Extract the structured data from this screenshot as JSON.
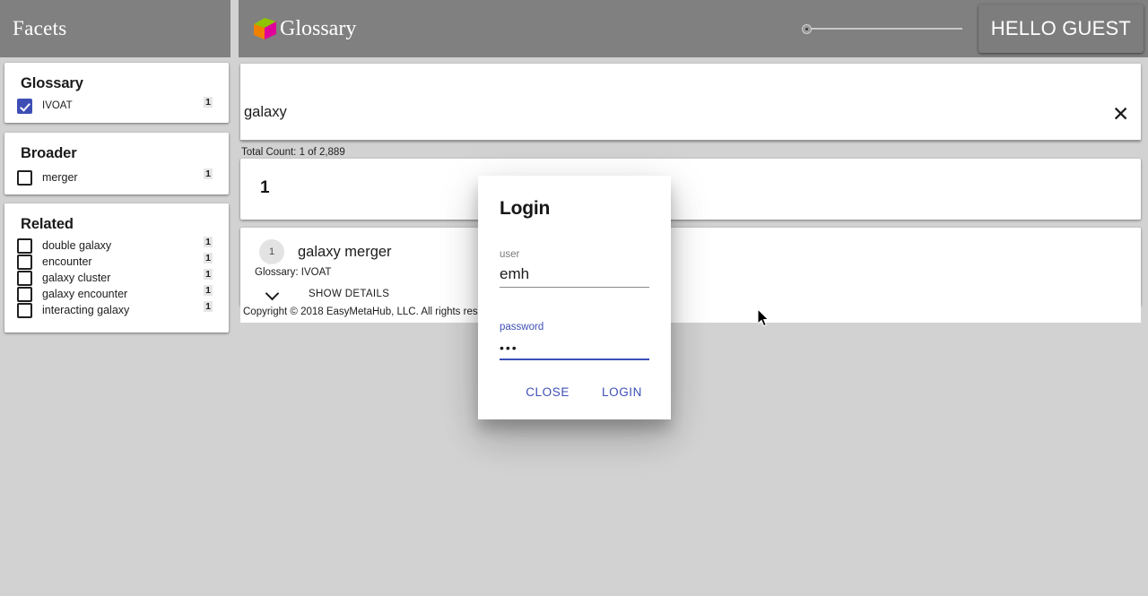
{
  "sidebar": {
    "header_title": "Facets",
    "facets": [
      {
        "id": "glossary",
        "title": "Glossary",
        "items": [
          {
            "label": "IVOAT",
            "count": "1",
            "checked": true
          }
        ]
      },
      {
        "id": "broader",
        "title": "Broader",
        "items": [
          {
            "label": "merger",
            "count": "1",
            "checked": false
          }
        ]
      },
      {
        "id": "related",
        "title": "Related",
        "items": [
          {
            "label": "double galaxy",
            "count": "1",
            "checked": false
          },
          {
            "label": "encounter",
            "count": "1",
            "checked": false
          },
          {
            "label": "galaxy cluster",
            "count": "1",
            "checked": false
          },
          {
            "label": "galaxy encounter",
            "count": "1",
            "checked": false
          },
          {
            "label": "interacting galaxy",
            "count": "1",
            "checked": false
          }
        ]
      }
    ]
  },
  "header": {
    "brand_text": "Glossary",
    "logo_icon": "cube-logo-icon",
    "slider_icon": "zoom-slider",
    "slider_value": "0",
    "user_button_label": "HELLO GUEST"
  },
  "search": {
    "value": "galaxy",
    "placeholder": "",
    "clear_icon": "✕",
    "total_count_text": "Total Count: 1 of 2,889"
  },
  "results": {
    "count_label": "1",
    "items": [
      {
        "badge": "1",
        "title": "galaxy merger",
        "subtitle": "Glossary: IVOAT",
        "details_label": "SHOW DETAILS",
        "details_icon": "chevron-down-icon"
      }
    ]
  },
  "footer": {
    "copyright": "Copyright © 2018 EasyMetaHub, LLC. All rights reserved."
  },
  "login_dialog": {
    "title": "Login",
    "user_label": "user",
    "user_value": "emh",
    "password_label": "password",
    "password_value": "•••",
    "close_label": "CLOSE",
    "login_label": "LOGIN"
  },
  "colors": {
    "header_bg": "#808080",
    "page_bg": "#d2d2d2",
    "accent": "#3d4fb5",
    "card_bg": "#ffffff",
    "logo_top": "#8ec400",
    "logo_left": "#f08000",
    "logo_right": "#e0009a"
  }
}
